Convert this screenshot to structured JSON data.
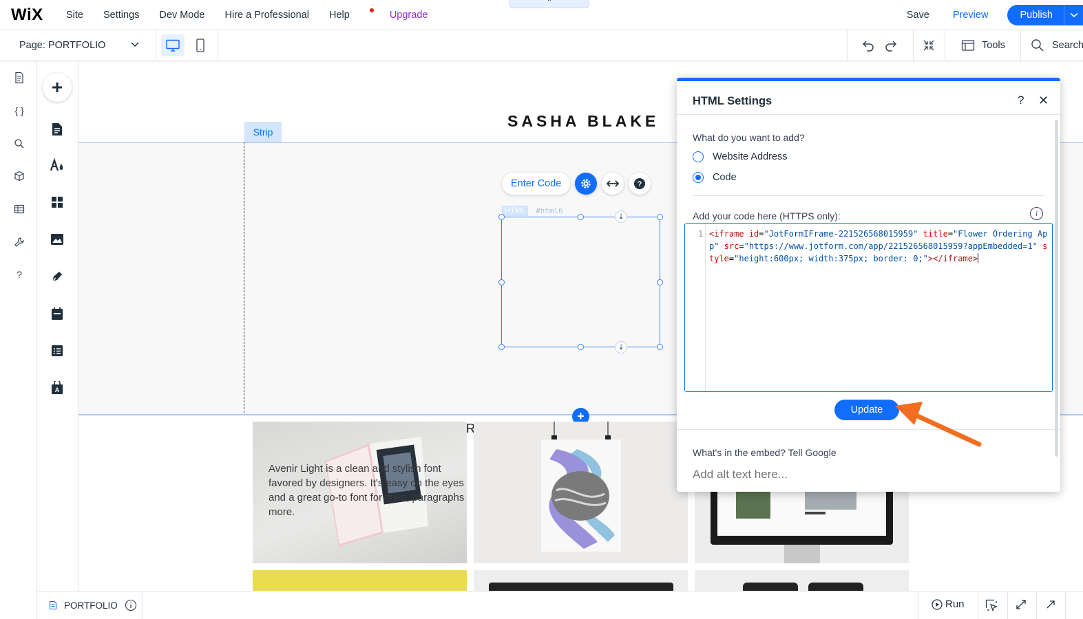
{
  "topbar": {
    "logo": "WiX",
    "nav": [
      "Site",
      "Settings",
      "Dev Mode",
      "Hire a Professional",
      "Help",
      "Upgrade"
    ],
    "save": "Save",
    "preview": "Preview",
    "publish": "Publish",
    "collapse_glyph": "⌃"
  },
  "subbar": {
    "page_prefix": "Page: ",
    "page_name": "PORTFOLIO",
    "tools": "Tools",
    "search": "Search"
  },
  "canvas": {
    "site_title": "SASHA BLAKE",
    "strip_tag": "Strip",
    "enter_code": "Enter Code",
    "html_tag": "HTML",
    "html_id": "#html6",
    "stray_letter": "R",
    "tile1_text": "Avenir Light is a clean and stylish font favored by designers. It's easy on the eyes and a great go-to font for titles, paragraphs & more."
  },
  "dialog": {
    "title": "HTML Settings",
    "help": "?",
    "close": "✕",
    "question": "What do you want to add?",
    "options": [
      {
        "label": "Website Address",
        "selected": false
      },
      {
        "label": "Code",
        "selected": true
      }
    ],
    "code_label": "Add your code here (HTTPS only):",
    "line_number": "1",
    "code": {
      "t1": "<iframe ",
      "a1": "id",
      "e1": "=",
      "v1": "\"JotFormIFrame-221526568015959\"",
      "a2": " title",
      "e2": "=",
      "v2": "\"Flower Ordering App\"",
      "a3": " src",
      "e3": "=",
      "v3": "\"https://www.jotform.com/app/221526568015959?appEmbedded=1\"",
      "a4": " style",
      "e4": "=",
      "v4": "\"height:600px; width:375px; border: 0;\"",
      "t2": "></iframe>"
    },
    "update": "Update",
    "alt_label": "What's in the embed? Tell Google",
    "alt_placeholder": "Add alt text here..."
  },
  "bottombar": {
    "page": "PORTFOLIO",
    "run": "Run"
  },
  "colors": {
    "accent": "#116dff",
    "upgrade": "#9a27d5",
    "arrow": "#f36d21"
  }
}
